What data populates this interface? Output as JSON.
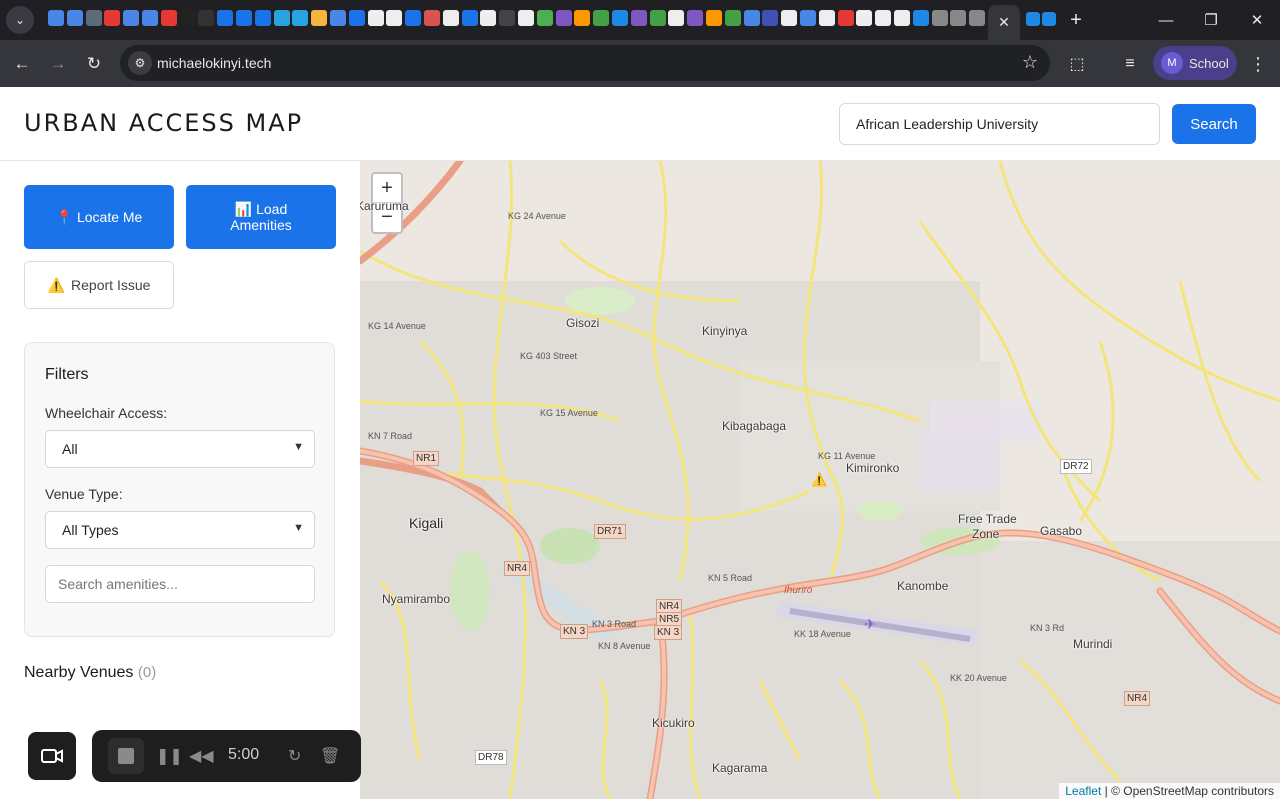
{
  "browser": {
    "url": "michaelokinyi.tech",
    "profile_initial": "M",
    "profile_name": "School",
    "active_tab_close": "✕",
    "new_tab": "+",
    "favicon_colors": [
      "#4a86e8",
      "#4a86e8",
      "#5b6b7b",
      "#e53935",
      "#4a86e8",
      "#4a86e8",
      "#e53935",
      "#222",
      "#333",
      "#1a73e8",
      "#1a73e8",
      "#1a73e8",
      "#29a3e0",
      "#29a3e0",
      "#f3b440",
      "#4a86e8",
      "#1a73e8",
      "#eee",
      "#eee",
      "#1a73e8",
      "#d9534f",
      "#eee",
      "#1a73e8",
      "#eee",
      "#444",
      "#eee",
      "#4caf50",
      "#7e57c2",
      "#ff9800",
      "#43a047",
      "#1e88e5",
      "#7e57c2",
      "#43a047",
      "#eee",
      "#7e57c2",
      "#ff9800",
      "#43a047",
      "#4a86e8",
      "#3f51b5",
      "#eee",
      "#4a86e8",
      "#eee",
      "#e53935",
      "#eee",
      "#eee",
      "#eee",
      "#1e88e5",
      "#888",
      "#888",
      "#888"
    ]
  },
  "header": {
    "brand": "URBAN ACCESS MAP",
    "search_value": "African Leadership University",
    "search_label": "Search"
  },
  "sidebar": {
    "locate_label": "📍 Locate Me",
    "load_label_1": "📊 Load",
    "load_label_2": "Amenities",
    "report_icon": "⚠️",
    "report_label": "Report Issue",
    "filters_title": "Filters",
    "wheelchair_label": "Wheelchair Access:",
    "wheelchair_value": "All",
    "venue_label": "Venue Type:",
    "venue_value": "All Types",
    "search_placeholder": "Search amenities...",
    "nearby_label": "Nearby Venues",
    "nearby_count": "(0)"
  },
  "recorder": {
    "time": "5:00"
  },
  "map": {
    "zoom_in": "+",
    "zoom_out": "−",
    "attribution_leaflet": "Leaflet",
    "attribution_rest": "| © OpenStreetMap contributors",
    "places": {
      "karuruma": "Karuruma",
      "gisozi": "Gisozi",
      "kinyinya": "Kinyinya",
      "kibagabaga": "Kibagabaga",
      "kimironko": "Kimironko",
      "free_trade_1": "Free Trade",
      "free_trade_2": "Zone",
      "gasabo": "Gasabo",
      "kigali": "Kigali",
      "nyamirambo": "Nyamirambo",
      "kanombe": "Kanombe",
      "murindi": "Murindi",
      "kicukiro": "Kicukiro",
      "kagarama": "Kagarama",
      "ihuriro": "Ihuriro"
    },
    "shields": {
      "nr1": "NR1",
      "nr4": "NR4",
      "dr71": "DR71",
      "dr72": "DR72",
      "kn3": "KN 3",
      "nr4b": "NR4",
      "nr5": "NR5",
      "kn3b": "KN 3",
      "nr4c": "NR4",
      "dr78": "DR78"
    },
    "roads": {
      "kn7": "KN 7 Road",
      "kg14": "KG 14 Avenue",
      "kg15": "KG 15 Avenue",
      "kg11": "KG 11 Avenue",
      "kn5": "KN 5 Road",
      "kn3r": "KN 3 Road",
      "kk18": "KK 18 Avenue",
      "kn3rd": "KN 3 Rd",
      "kk20": "KK 20 Avenue",
      "kg24": "KG 24 Avenue",
      "kg403": "KG 403 Street",
      "kn8": "KN 8 Avenue"
    }
  }
}
